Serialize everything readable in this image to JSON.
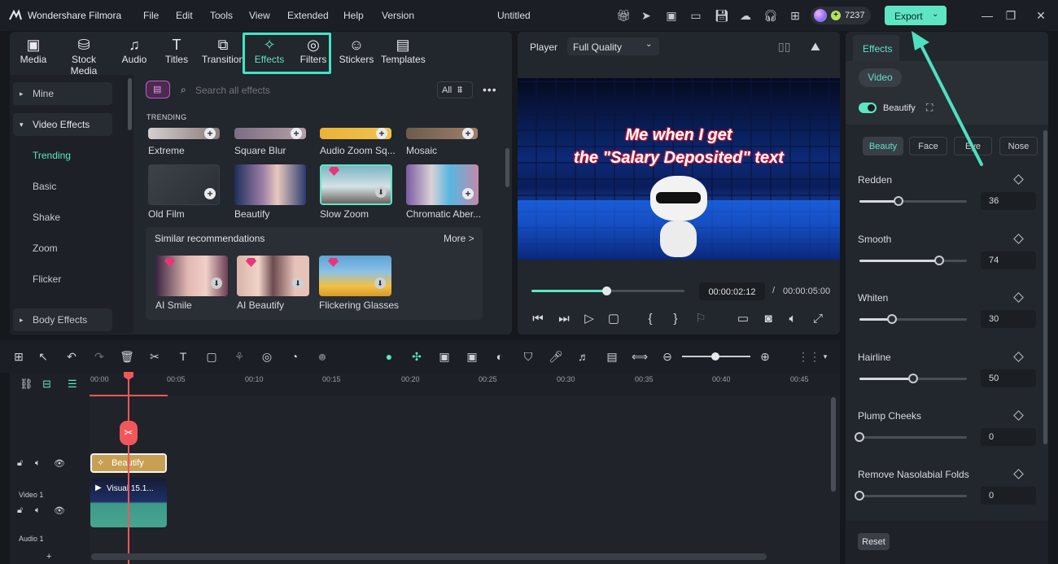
{
  "app": {
    "name": "Wondershare Filmora",
    "menu": [
      "File",
      "Edit",
      "Tools",
      "View",
      "Extended",
      "Help",
      "Version"
    ],
    "project_title": "Untitled",
    "credits": "7237",
    "export_label": "Export"
  },
  "nav_tabs": [
    "Media",
    "Stock Media",
    "Audio",
    "Titles",
    "Transition",
    "Effects",
    "Filters",
    "Stickers",
    "Templates"
  ],
  "sidebar": {
    "items": [
      "Mine",
      "Video Effects",
      "Trending",
      "Basic",
      "Shake",
      "Zoom",
      "Flicker",
      "Body Effects"
    ]
  },
  "search": {
    "placeholder": "Search all effects",
    "filter_label": "All"
  },
  "effects": {
    "section": "TRENDING",
    "row1": [
      "Extreme",
      "Square Blur",
      "Audio Zoom Sq...",
      "Mosaic"
    ],
    "row2": [
      "Old Film",
      "Beautify",
      "Slow Zoom",
      "Chromatic Aber..."
    ],
    "similar_title": "Similar recommendations",
    "more_label": "More >",
    "similar": [
      "AI Smile",
      "AI Beautify",
      "Flickering Glasses"
    ]
  },
  "player": {
    "label": "Player",
    "quality": "Full Quality",
    "caption_line1": "Me when I get",
    "caption_line2": "the \"Salary Deposited\" text",
    "current_time": "00:00:02:12",
    "separator": "/",
    "total_time": "00:00:05:00",
    "progress": 0.49
  },
  "timeline": {
    "ruler": [
      "00:00",
      "00:05",
      "00:10",
      "00:15",
      "00:20",
      "00:25",
      "00:30",
      "00:35",
      "00:40",
      "00:45"
    ],
    "effect_clip": "Beautify",
    "video_clip": "Visual 15.1...",
    "track_video": "Video 1",
    "track_audio": "Audio 1"
  },
  "properties": {
    "tab": "Effects",
    "subtab": "Video",
    "effect_name": "Beautify",
    "modes": [
      "Beauty",
      "Face",
      "Eye",
      "Nose"
    ],
    "params": [
      {
        "label": "Redden",
        "value": "36",
        "level": 0.36
      },
      {
        "label": "Smooth",
        "value": "74",
        "level": 0.74
      },
      {
        "label": "Whiten",
        "value": "30",
        "level": 0.3
      },
      {
        "label": "Hairline",
        "value": "50",
        "level": 0.5
      },
      {
        "label": "Plump Cheeks",
        "value": "0",
        "level": 0
      },
      {
        "label": "Remove Nasolabial Folds",
        "value": "0",
        "level": 0
      }
    ],
    "reset_label": "Reset"
  },
  "colors": {
    "accent": "#4fe0c0",
    "export_bg": "#5ee6c4",
    "highlight_box": "#3fe6c3",
    "playhead": "#f0575b",
    "effect_clip": "#c8a054"
  }
}
